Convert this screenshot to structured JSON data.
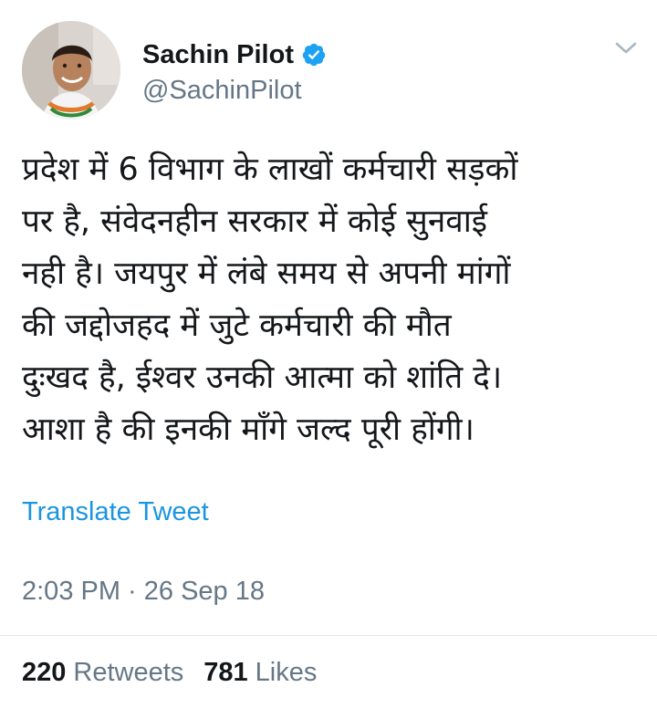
{
  "author": {
    "display_name": "Sachin Pilot",
    "handle": "@SachinPilot",
    "verified_icon": "verified-badge-icon",
    "avatar_icon": "profile-photo"
  },
  "menu_icon": "chevron-down-icon",
  "tweet": {
    "text": "प्रदेश में 6 विभाग के लाखों कर्मचारी सड़कों\nपर है, संवेदनहीन सरकार में कोई सुनवाई\nनही है। जयपुर में लंबे समय से अपनी मांगों\nकी जद्दोजहद में जुटे कर्मचारी की मौत\nदुःखद है,  ईश्वर उनकी आत्मा को शांति दे।\nआशा है की इनकी माँगे जल्द पूरी होंगी।",
    "translate_label": "Translate Tweet",
    "timestamp": "2:03 PM · 26 Sep 18"
  },
  "stats": {
    "retweets_count": "220",
    "retweets_label": "Retweets",
    "likes_count": "781",
    "likes_label": "Likes"
  },
  "colors": {
    "accent": "#1b95e0",
    "verified": "#1da1f2",
    "secondary_text": "#657786",
    "primary_text": "#14171a",
    "divider": "#e1e8ed"
  }
}
